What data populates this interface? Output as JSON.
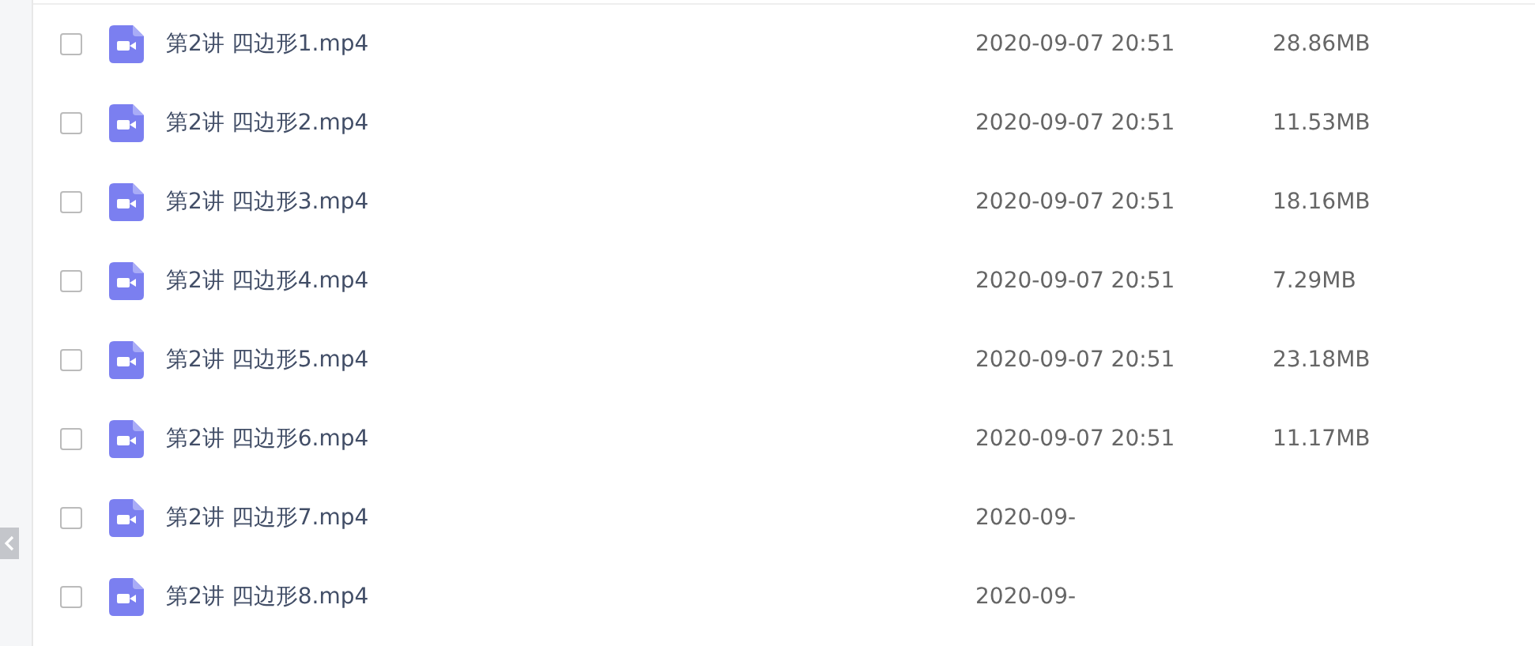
{
  "files": [
    {
      "name": "第2讲 四边形1.mp4",
      "checked": false,
      "date": "2020-09-07 20:51",
      "size": "28.86MB"
    },
    {
      "name": "第2讲 四边形2.mp4",
      "checked": false,
      "date": "2020-09-07 20:51",
      "size": "11.53MB"
    },
    {
      "name": "第2讲 四边形3.mp4",
      "checked": false,
      "date": "2020-09-07 20:51",
      "size": "18.16MB"
    },
    {
      "name": "第2讲 四边形4.mp4",
      "checked": false,
      "date": "2020-09-07 20:51",
      "size": "7.29MB"
    },
    {
      "name": "第2讲 四边形5.mp4",
      "checked": false,
      "date": "2020-09-07 20:51",
      "size": "23.18MB"
    },
    {
      "name": "第2讲 四边形6.mp4",
      "checked": false,
      "date": "2020-09-07 20:51",
      "size": "11.17MB"
    },
    {
      "name": "第2讲 四边形7.mp4",
      "checked": false,
      "date": "2020-09-"
    },
    {
      "name": "第2讲 四边形8.mp4",
      "checked": false,
      "date": "2020-09-"
    }
  ]
}
